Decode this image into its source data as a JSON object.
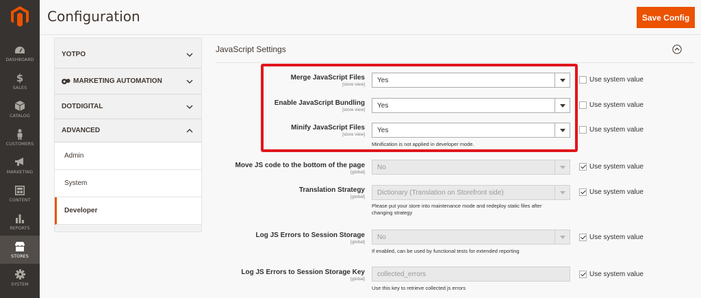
{
  "nav": {
    "items": [
      {
        "label": "DASHBOARD",
        "icon": "dashboard-icon"
      },
      {
        "label": "SALES",
        "icon": "dollar-icon"
      },
      {
        "label": "CATALOG",
        "icon": "cube-icon"
      },
      {
        "label": "CUSTOMERS",
        "icon": "person-icon"
      },
      {
        "label": "MARKETING",
        "icon": "megaphone-icon"
      },
      {
        "label": "CONTENT",
        "icon": "layout-icon"
      },
      {
        "label": "REPORTS",
        "icon": "bar-chart-icon"
      },
      {
        "label": "STORES",
        "icon": "store-icon"
      },
      {
        "label": "SYSTEM",
        "icon": "gear-icon"
      }
    ]
  },
  "header": {
    "title": "Configuration",
    "save_label": "Save Config"
  },
  "tabs": {
    "groups": [
      {
        "label": "YOTPO",
        "state": "collapsed"
      },
      {
        "label": "MARKETING AUTOMATION",
        "state": "collapsed"
      },
      {
        "label": "DOTDIGITAL",
        "state": "collapsed"
      },
      {
        "label": "ADVANCED",
        "state": "expanded"
      }
    ],
    "sub_items": [
      {
        "label": "Admin"
      },
      {
        "label": "System"
      },
      {
        "label": "Developer",
        "active": true
      }
    ]
  },
  "section": {
    "title": "JavaScript Settings",
    "rows": [
      {
        "label": "Merge JavaScript Files",
        "scope": "[store view]",
        "value": "Yes",
        "use_system": false
      },
      {
        "label": "Enable JavaScript Bundling",
        "scope": "[store view]",
        "value": "Yes",
        "use_system": false
      },
      {
        "label": "Minify JavaScript Files",
        "scope": "[store view]",
        "value": "Yes",
        "use_system": false,
        "note": "Minification is not applied in developer mode."
      },
      {
        "label": "Move JS code to the bottom of the page",
        "scope": "[global]",
        "value": "No",
        "use_system": true
      },
      {
        "label": "Translation Strategy",
        "scope": "[global]",
        "value": "Dictionary (Translation on Storefront side)",
        "use_system": true,
        "note": "Please put your store into maintenance mode and redeploy static files after changing strategy"
      },
      {
        "label": "Log JS Errors to Session Storage",
        "scope": "[global]",
        "value": "No",
        "use_system": true,
        "note": "If enabled, can be used by functional tests for extended reporting"
      },
      {
        "label": "Log JS Errors to Session Storage Key",
        "scope": "[global]",
        "value": "collected_errors",
        "use_system": true,
        "note": "Use this key to retrieve collected js errors"
      }
    ],
    "use_system_label": "Use system value"
  },
  "colors": {
    "accent": "#eb5202",
    "highlight": "#e0161c",
    "nav_bg": "#373330"
  }
}
